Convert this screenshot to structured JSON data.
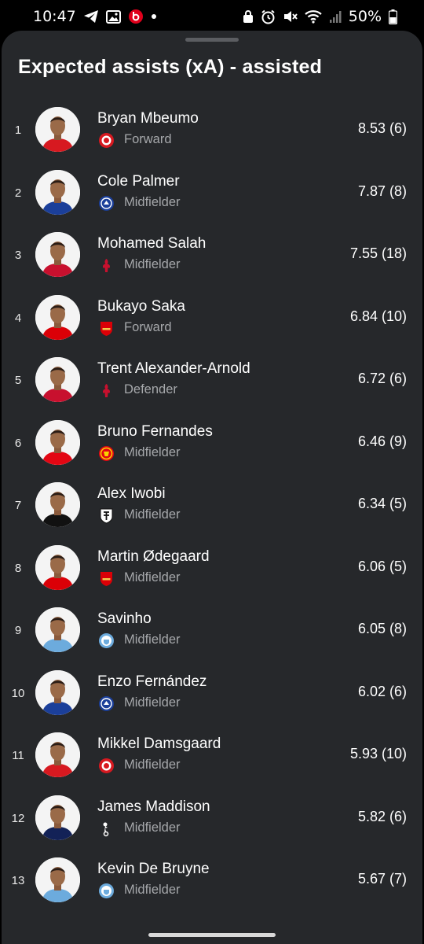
{
  "status_bar": {
    "time": "10:47",
    "battery": "50%",
    "left_icons": [
      "telegram-icon",
      "gallery-icon",
      "beats-icon",
      "dot-icon"
    ],
    "right_icons": [
      "lock-icon",
      "alarm-icon",
      "mute-icon",
      "wifi-icon",
      "signal-icon",
      "battery-icon"
    ]
  },
  "sheet": {
    "title": "Expected assists (xA) - assisted"
  },
  "colors": {
    "sheet_bg": "#26282b",
    "muted_text": "#a6a8ab",
    "brentford": "#d71920",
    "chelsea": "#1b3f9a",
    "liverpool": "#c8102e",
    "arsenal": "#db0007",
    "man_utd": "#e30613",
    "fulham": "#111111",
    "man_city": "#6cabdd",
    "tottenham": "#132257"
  },
  "players": [
    {
      "rank": "1",
      "name": "Bryan Mbeumo",
      "position": "Forward",
      "value": "8.53 (6)",
      "club_icon": "brentford-crest-icon"
    },
    {
      "rank": "2",
      "name": "Cole Palmer",
      "position": "Midfielder",
      "value": "7.87 (8)",
      "club_icon": "chelsea-crest-icon"
    },
    {
      "rank": "3",
      "name": "Mohamed Salah",
      "position": "Midfielder",
      "value": "7.55 (18)",
      "club_icon": "liverpool-crest-icon"
    },
    {
      "rank": "4",
      "name": "Bukayo Saka",
      "position": "Forward",
      "value": "6.84 (10)",
      "club_icon": "arsenal-crest-icon"
    },
    {
      "rank": "5",
      "name": "Trent Alexander-Arnold",
      "position": "Defender",
      "value": "6.72 (6)",
      "club_icon": "liverpool-crest-icon"
    },
    {
      "rank": "6",
      "name": "Bruno Fernandes",
      "position": "Midfielder",
      "value": "6.46 (9)",
      "club_icon": "man-utd-crest-icon"
    },
    {
      "rank": "7",
      "name": "Alex Iwobi",
      "position": "Midfielder",
      "value": "6.34 (5)",
      "club_icon": "fulham-crest-icon"
    },
    {
      "rank": "8",
      "name": "Martin Ødegaard",
      "position": "Midfielder",
      "value": "6.06 (5)",
      "club_icon": "arsenal-crest-icon"
    },
    {
      "rank": "9",
      "name": "Savinho",
      "position": "Midfielder",
      "value": "6.05 (8)",
      "club_icon": "man-city-crest-icon"
    },
    {
      "rank": "10",
      "name": "Enzo Fernández",
      "position": "Midfielder",
      "value": "6.02 (6)",
      "club_icon": "chelsea-crest-icon"
    },
    {
      "rank": "11",
      "name": "Mikkel Damsgaard",
      "position": "Midfielder",
      "value": "5.93 (10)",
      "club_icon": "brentford-crest-icon"
    },
    {
      "rank": "12",
      "name": "James Maddison",
      "position": "Midfielder",
      "value": "5.82 (6)",
      "club_icon": "tottenham-crest-icon"
    },
    {
      "rank": "13",
      "name": "Kevin De Bruyne",
      "position": "Midfielder",
      "value": "5.67 (7)",
      "club_icon": "man-city-crest-icon"
    }
  ]
}
